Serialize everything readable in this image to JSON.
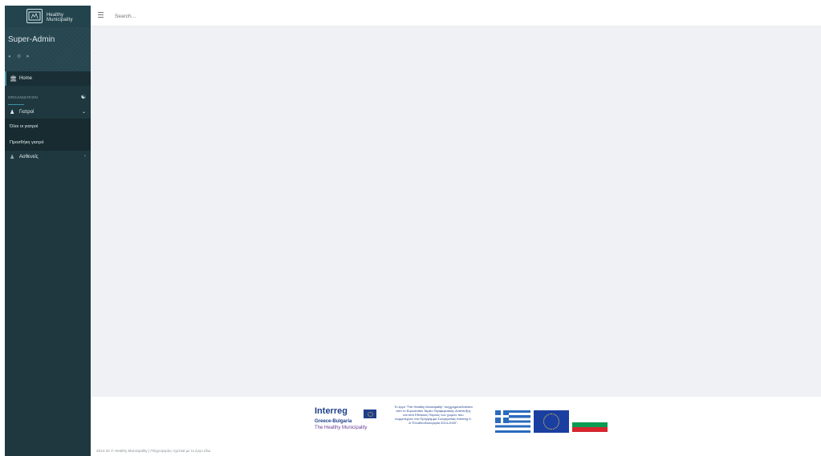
{
  "app": {
    "brand": "Healthy Municipality"
  },
  "profile": {
    "name": "Super-Admin",
    "icons": [
      "user-icon",
      "gear-icon",
      "logout-icon"
    ]
  },
  "sidebar": {
    "home_label": "Home",
    "section_label": "ORGANIZATION",
    "doctors_label": "Γιατροί",
    "doctors_submenu": [
      "Όλοι οι γιατροί",
      "Προσθήκη γιατρό"
    ],
    "patients_label": "Ασθενείς"
  },
  "header": {
    "search_placeholder": "Search..."
  },
  "footer": {
    "interreg_title": "Interreg",
    "interreg_sub": "Greece-Bulgaria",
    "interreg_sub2": "The Healthy Municipality",
    "project_text": "Το έργο \"The Healthy Municipality\" συγχρηματοδοτείται από το Ευρωπαϊκό Ταμείο Περιφερειακής Ανάπτυξης και από Εθνικούς Πόρους των χωρών που συμμετέχουν στο Πρόγραμμα Συνεργασίας Interreg V-A \"Ελλάδα-Βουλγαρία 2014-2020\".",
    "copyright": "2014-22 © Healthy Municipality | Πληροφορίες σχετικά με το έργο εδώ"
  },
  "colors": {
    "sidebar": "#1f3840",
    "accent": "#3f8fa3",
    "content_bg": "#f0f1f4",
    "interreg_blue": "#1d3f8a"
  }
}
